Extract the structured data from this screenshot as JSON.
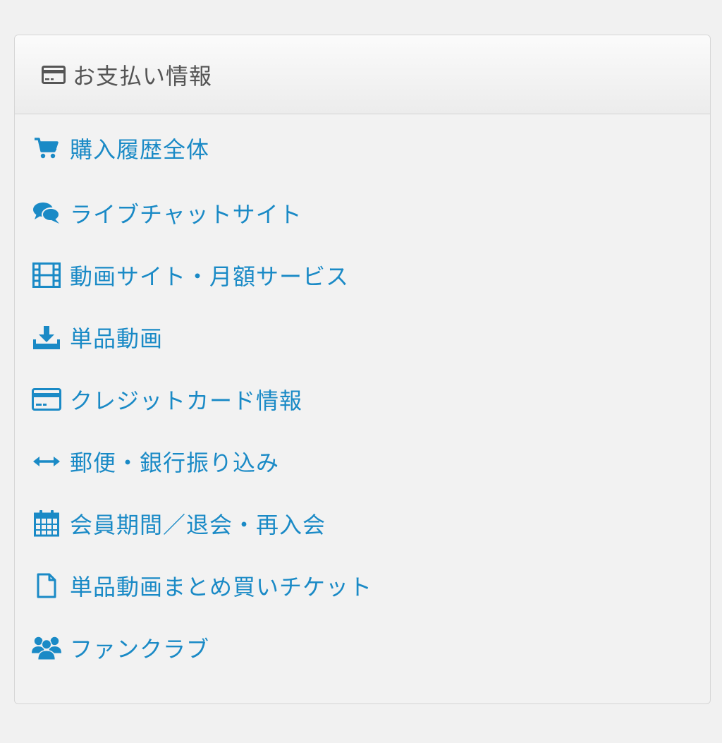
{
  "panel": {
    "title": "お支払い情報",
    "title_icon": "credit-card-icon",
    "accent_color": "#1a8ac6",
    "items": [
      {
        "label": "購入履歴全体",
        "icon": "cart-icon"
      },
      {
        "label": "ライブチャットサイト",
        "icon": "chat-bubbles-icon"
      },
      {
        "label": "動画サイト・月額サービス",
        "icon": "film-icon"
      },
      {
        "label": "単品動画",
        "icon": "download-icon"
      },
      {
        "label": "クレジットカード情報",
        "icon": "credit-card-icon"
      },
      {
        "label": "郵便・銀行振り込み",
        "icon": "transfer-arrows-icon"
      },
      {
        "label": "会員期間／退会・再入会",
        "icon": "calendar-icon"
      },
      {
        "label": "単品動画まとめ買いチケット",
        "icon": "document-icon"
      },
      {
        "label": "ファンクラブ",
        "icon": "group-icon"
      }
    ]
  }
}
